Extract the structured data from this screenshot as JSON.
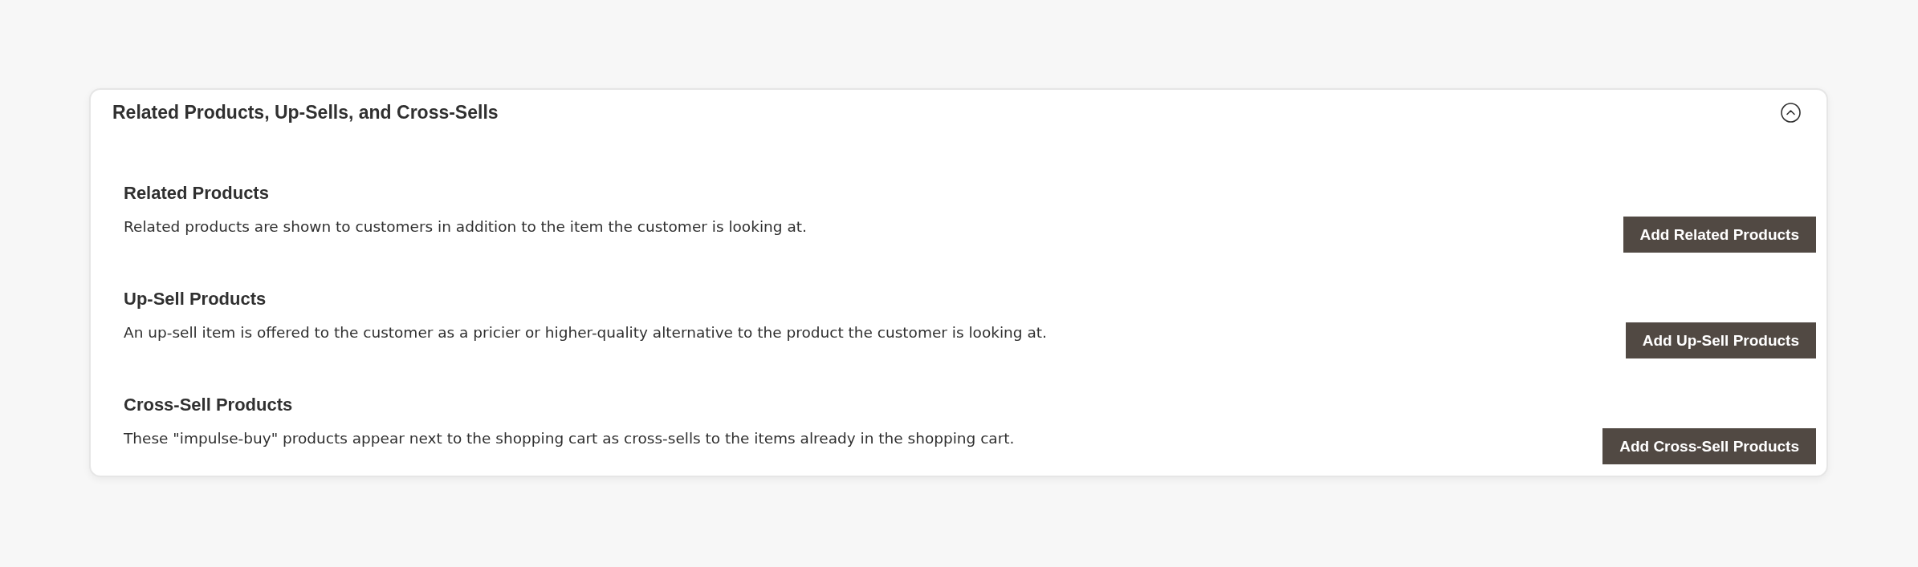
{
  "panel": {
    "title": "Related Products, Up-Sells, and Cross-Sells",
    "expanded": true
  },
  "sections": [
    {
      "title": "Related Products",
      "description": "Related products are shown to customers in addition to the item the customer is looking at.",
      "button": "Add Related Products"
    },
    {
      "title": "Up-Sell Products",
      "description": "An up-sell item is offered to the customer as a pricier or higher-quality alternative to the product the customer is looking at.",
      "button": "Add Up-Sell Products"
    },
    {
      "title": "Cross-Sell Products",
      "description": "These \"impulse-buy\" products appear next to the shopping cart as cross-sells to the items already in the shopping cart.",
      "button": "Add Cross-Sell Products"
    }
  ]
}
